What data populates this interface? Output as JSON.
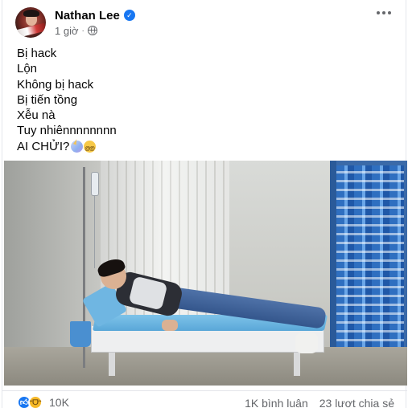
{
  "post": {
    "author": "Nathan Lee",
    "verified_icon": "verified-badge-icon",
    "time": "1 giờ",
    "privacy_icon": "globe-icon",
    "more_icon": "more-options-icon",
    "content_lines": [
      "Bị hack",
      "Lộn",
      "Không bị hack",
      "Bị tiến tồng",
      "Xễu nà",
      "Tuy nhiênnnnnnnn",
      "AI CHỬI?"
    ],
    "trailing_emojis": [
      "unicorn",
      "dizzy-face"
    ]
  },
  "footer": {
    "reaction_icons": [
      "like-icon",
      "haha-icon"
    ],
    "reaction_count": "10K",
    "comments": "1K bình luận",
    "shares": "23 lượt chia sẻ"
  },
  "colors": {
    "accent": "#1877f2",
    "secondary_text": "#65676b",
    "primary_text": "#050505"
  }
}
